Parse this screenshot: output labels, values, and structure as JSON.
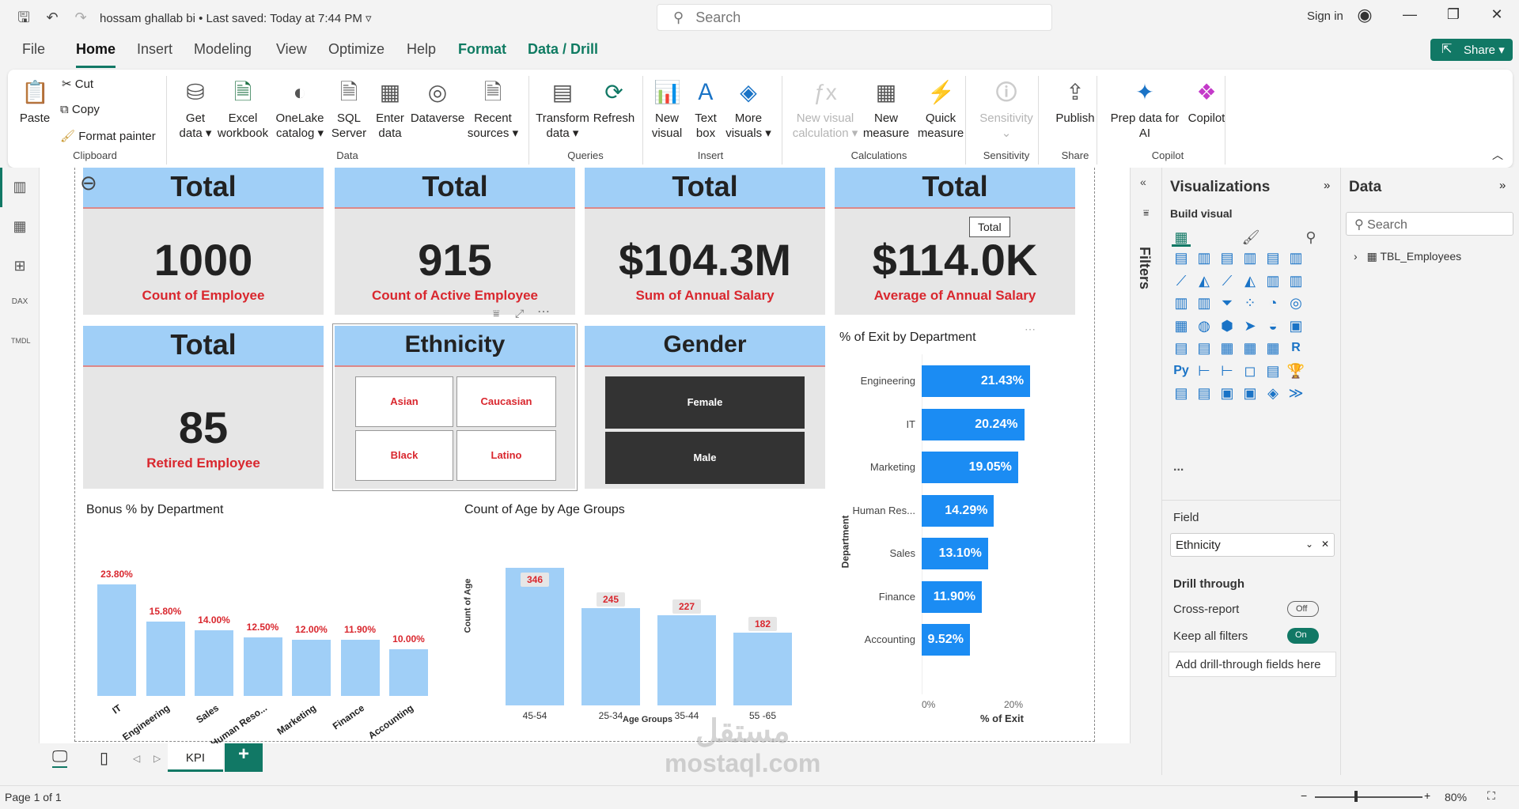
{
  "titlebar": {
    "filename": "hossam ghallab bi",
    "saved": "Last saved: Today at 7:44 PM",
    "search_placeholder": "Search",
    "signin": "Sign in"
  },
  "menu": {
    "file": "File",
    "home": "Home",
    "insert": "Insert",
    "modeling": "Modeling",
    "view": "View",
    "optimize": "Optimize",
    "help": "Help",
    "format": "Format",
    "data_drill": "Data / Drill",
    "share": "Share"
  },
  "ribbon": {
    "paste": "Paste",
    "cut": "Cut",
    "copy": "Copy",
    "format_painter": "Format painter",
    "clipboard": "Clipboard",
    "get_data": [
      "Get",
      "data"
    ],
    "excel": [
      "Excel",
      "workbook"
    ],
    "onelake": [
      "OneLake",
      "catalog"
    ],
    "sql": [
      "SQL",
      "Server"
    ],
    "enter_data": [
      "Enter",
      "data"
    ],
    "dataverse": "Dataverse",
    "recent": [
      "Recent",
      "sources"
    ],
    "data": "Data",
    "transform": [
      "Transform",
      "data"
    ],
    "refresh": "Refresh",
    "queries": "Queries",
    "new_visual": [
      "New",
      "visual"
    ],
    "text_box": [
      "Text",
      "box"
    ],
    "more_visuals": [
      "More",
      "visuals"
    ],
    "insert": "Insert",
    "new_calc": [
      "New visual",
      "calculation"
    ],
    "new_measure": [
      "New",
      "measure"
    ],
    "quick_measure": [
      "Quick",
      "measure"
    ],
    "calculations": "Calculations",
    "sensitivity": "Sensitivity",
    "sensitivity_grp": "Sensitivity",
    "publish": "Publish",
    "share_grp": "Share",
    "prep": [
      "Prep data for",
      "AI"
    ],
    "copilot": "Copilot",
    "copilot_grp": "Copilot"
  },
  "cards": [
    {
      "header": "Total",
      "value": "1000",
      "label": "Count of Employee"
    },
    {
      "header": "Total",
      "value": "915",
      "label": "Count of Active Employee"
    },
    {
      "header": "Total",
      "value": "$104.3M",
      "label": "Sum of Annual Salary"
    },
    {
      "header": "Total",
      "value": "$114.0K",
      "label": "Average of Annual Salary"
    },
    {
      "header": "Total",
      "value": "85",
      "label": "Retired Employee"
    }
  ],
  "tooltip": "Total",
  "ethnicity": {
    "title": "Ethnicity",
    "options": [
      "Asian",
      "Caucasian",
      "Black",
      "Latino"
    ]
  },
  "gender": {
    "title": "Gender",
    "options": [
      "Female",
      "Male"
    ]
  },
  "bonus_chart": {
    "title": "Bonus % by Department"
  },
  "age_chart": {
    "title": "Count of Age by Age Groups",
    "xlabel": "Age Groups",
    "ylabel": "Count of Age"
  },
  "exit_chart": {
    "title": "% of Exit by Department",
    "xlabel": "% of Exit",
    "ylabel": "Department",
    "ticks": [
      "0%",
      "20%"
    ]
  },
  "chart_data": [
    {
      "type": "bar",
      "title": "Bonus % by Department",
      "categories": [
        "IT",
        "Engineering",
        "Sales",
        "Human Reso...",
        "Marketing",
        "Finance",
        "Accounting"
      ],
      "values": [
        23.8,
        15.8,
        14.0,
        12.5,
        12.0,
        11.9,
        10.0
      ],
      "labels": [
        "23.80%",
        "15.80%",
        "14.00%",
        "12.50%",
        "12.00%",
        "11.90%",
        "10.00%"
      ],
      "color": "#a0cff7"
    },
    {
      "type": "bar",
      "title": "Count of Age by Age Groups",
      "categories": [
        "45-54",
        "25-34",
        "35-44",
        "55 -65"
      ],
      "values": [
        346,
        245,
        227,
        182
      ],
      "xlabel": "Age Groups",
      "ylabel": "Count of Age",
      "color": "#a0cff7"
    },
    {
      "type": "bar",
      "orientation": "horizontal",
      "title": "% of Exit by Department",
      "categories": [
        "Engineering",
        "IT",
        "Marketing",
        "Human Res...",
        "Sales",
        "Finance",
        "Accounting"
      ],
      "values": [
        21.43,
        20.24,
        19.05,
        14.29,
        13.1,
        11.9,
        9.52
      ],
      "labels": [
        "21.43%",
        "20.24%",
        "19.05%",
        "14.29%",
        "13.10%",
        "11.90%",
        "9.52%"
      ],
      "xlabel": "% of Exit",
      "ylabel": "Department",
      "xlim": [
        0,
        25
      ],
      "color": "#1b8cf3"
    }
  ],
  "filters_label": "Filters",
  "viz": {
    "title": "Visualizations",
    "build": "Build visual",
    "field": "Field",
    "field_value": "Ethnicity",
    "drill": "Drill through",
    "cross": "Cross-report",
    "cross_state": "Off",
    "keep": "Keep all filters",
    "keep_state": "On",
    "add_drill": "Add drill-through fields here",
    "more": "..."
  },
  "data_pane": {
    "title": "Data",
    "search": "Search",
    "table": "TBL_Employees"
  },
  "tabs": {
    "page": "KPI",
    "add": "+"
  },
  "status": {
    "page": "Page 1 of 1",
    "zoom": "80%"
  },
  "watermark": {
    "arabic": "مستقل",
    "latin": "mostaql.com"
  }
}
